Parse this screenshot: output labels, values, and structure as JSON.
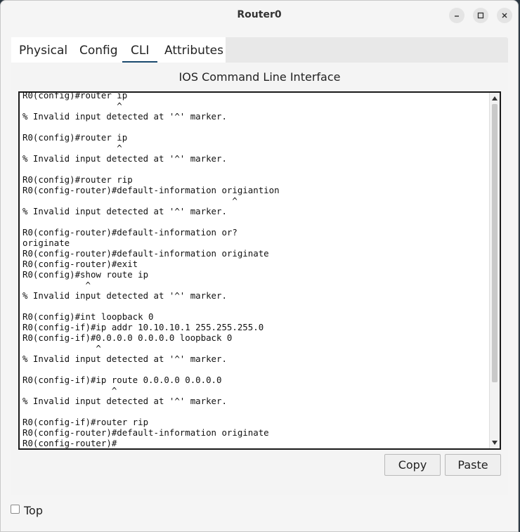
{
  "window": {
    "title": "Router0"
  },
  "tabs": [
    {
      "label": "Physical",
      "active": false
    },
    {
      "label": "Config",
      "active": false
    },
    {
      "label": "CLI",
      "active": true
    },
    {
      "label": "Attributes",
      "active": false
    }
  ],
  "cli": {
    "title": "IOS Command Line Interface",
    "lines": [
      "R0(config)#router ip",
      "                  ^",
      "% Invalid input detected at '^' marker.",
      "",
      "R0(config)#router ip",
      "                  ^",
      "% Invalid input detected at '^' marker.",
      "",
      "R0(config)#router rip",
      "R0(config-router)#default-information origiantion",
      "                                        ^",
      "% Invalid input detected at '^' marker.",
      "",
      "R0(config-router)#default-information or?",
      "originate",
      "R0(config-router)#default-information originate",
      "R0(config-router)#exit",
      "R0(config)#show route ip",
      "            ^",
      "% Invalid input detected at '^' marker.",
      "",
      "R0(config)#int loopback 0",
      "R0(config-if)#ip addr 10.10.10.1 255.255.255.0",
      "R0(config-if)#0.0.0.0 0.0.0.0 loopback 0",
      "              ^",
      "% Invalid input detected at '^' marker.",
      "",
      "R0(config-if)#ip route 0.0.0.0 0.0.0.0",
      "                 ^",
      "% Invalid input detected at '^' marker.",
      "",
      "R0(config-if)#router rip",
      "R0(config-router)#default-information originate",
      "R0(config-router)#"
    ]
  },
  "buttons": {
    "copy": "Copy",
    "paste": "Paste"
  },
  "footer": {
    "top_label": "Top",
    "top_checked": false
  },
  "icons": {
    "minimize": "minimize-icon",
    "maximize": "maximize-icon",
    "close": "close-icon"
  }
}
